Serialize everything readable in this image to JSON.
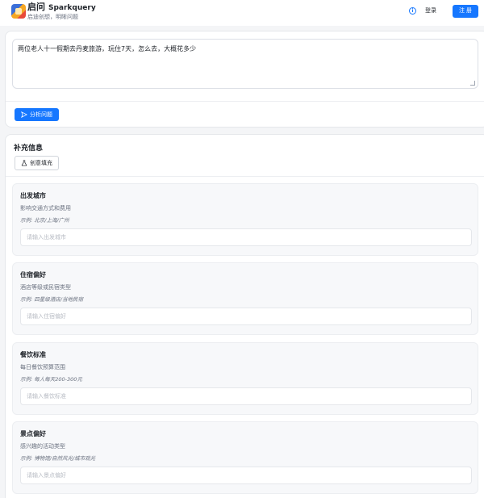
{
  "header": {
    "brand_title": "启问",
    "brand_en": "Sparkquery",
    "brand_subtitle": "启迪创想，明晰问题",
    "info_icon_glyph": "i",
    "login_label": "登录",
    "register_label": "注 册"
  },
  "question": {
    "text": "两位老人十一假期去丹麦旅游，玩住7天，怎么去，大概花多少",
    "analyze_label": "分析问题"
  },
  "supplement": {
    "title": "补充信息",
    "creative_fill_label": "创意填充",
    "fields": [
      {
        "label": "出发城市",
        "desc": "影响交通方式和费用",
        "example": "示例: 北京/上海/广州",
        "placeholder": "请输入出发城市",
        "value": ""
      },
      {
        "label": "住宿偏好",
        "desc": "酒店等级或民宿类型",
        "example": "示例: 四星级酒店/当地民宿",
        "placeholder": "请输入住宿偏好",
        "value": ""
      },
      {
        "label": "餐饮标准",
        "desc": "每日餐饮预算范围",
        "example": "示例: 每人每天200-300元",
        "placeholder": "请输入餐饮标准",
        "value": ""
      },
      {
        "label": "景点偏好",
        "desc": "感兴趣的活动类型",
        "example": "示例: 博物馆/自然风光/城市观光",
        "placeholder": "请输入景点偏好",
        "value": ""
      }
    ]
  },
  "colors": {
    "primary": "#1677ff",
    "background": "#f4f5f7",
    "card": "#ffffff"
  }
}
